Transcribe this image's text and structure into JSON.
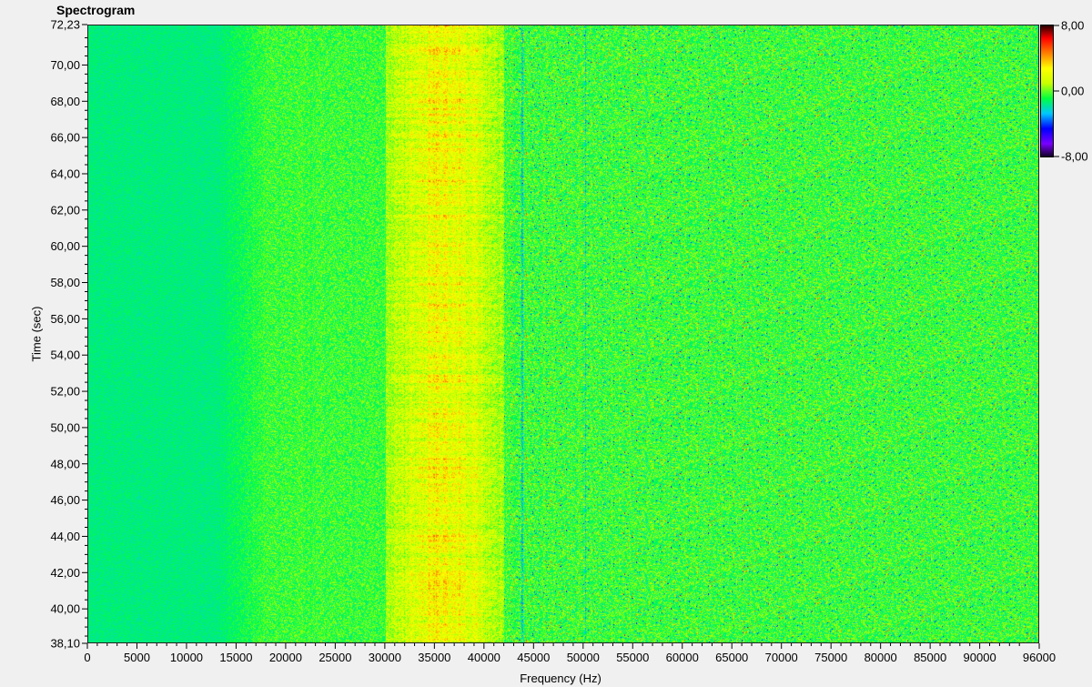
{
  "chart_data": {
    "type": "heatmap",
    "title": "Spectrogram",
    "xlabel": "Frequency (Hz)",
    "ylabel": "Time (sec)",
    "xlim": [
      0,
      96000
    ],
    "ylim": [
      38.1,
      72.23
    ],
    "x_ticks": [
      "0",
      "5000",
      "10000",
      "15000",
      "20000",
      "25000",
      "30000",
      "35000",
      "40000",
      "45000",
      "50000",
      "55000",
      "60000",
      "65000",
      "70000",
      "75000",
      "80000",
      "85000",
      "90000",
      "96000"
    ],
    "x_tick_values": [
      0,
      5000,
      10000,
      15000,
      20000,
      25000,
      30000,
      35000,
      40000,
      45000,
      50000,
      55000,
      60000,
      65000,
      70000,
      75000,
      80000,
      85000,
      90000,
      96000
    ],
    "y_ticks": [
      "38,10",
      "40,00",
      "42,00",
      "44,00",
      "46,00",
      "48,00",
      "50,00",
      "52,00",
      "54,00",
      "56,00",
      "58,00",
      "60,00",
      "62,00",
      "64,00",
      "66,00",
      "68,00",
      "70,00",
      "72,23"
    ],
    "y_tick_values": [
      38.1,
      40.0,
      42.0,
      44.0,
      46.0,
      48.0,
      50.0,
      52.0,
      54.0,
      56.0,
      58.0,
      60.0,
      62.0,
      64.0,
      66.0,
      68.0,
      70.0,
      72.23
    ],
    "colorbar": {
      "range": [
        -8,
        8
      ],
      "tick_labels": [
        "8,00",
        "0,00",
        "-8,00"
      ],
      "tick_values": [
        8,
        0,
        -8
      ],
      "colors": [
        "#000000",
        "#7a00ff",
        "#0000ff",
        "#00c8ff",
        "#00ff40",
        "#c8ff00",
        "#ffff00",
        "#ff8000",
        "#ff0000",
        "#000000"
      ]
    },
    "bands": [
      {
        "x_range": [
          0,
          15000
        ],
        "level": "low",
        "color": "green"
      },
      {
        "x_range": [
          15000,
          30000
        ],
        "level": "medium",
        "color": "green-yellow"
      },
      {
        "x_range": [
          30000,
          42000
        ],
        "level": "high",
        "color": "red"
      },
      {
        "x_range": [
          42000,
          96000
        ],
        "level": "medium",
        "color": "green-yellow"
      }
    ],
    "features": [
      {
        "x": 43800,
        "description": "narrow vertical line"
      },
      {
        "x": 50200,
        "description": "faint vertical line"
      }
    ],
    "grid": false
  }
}
